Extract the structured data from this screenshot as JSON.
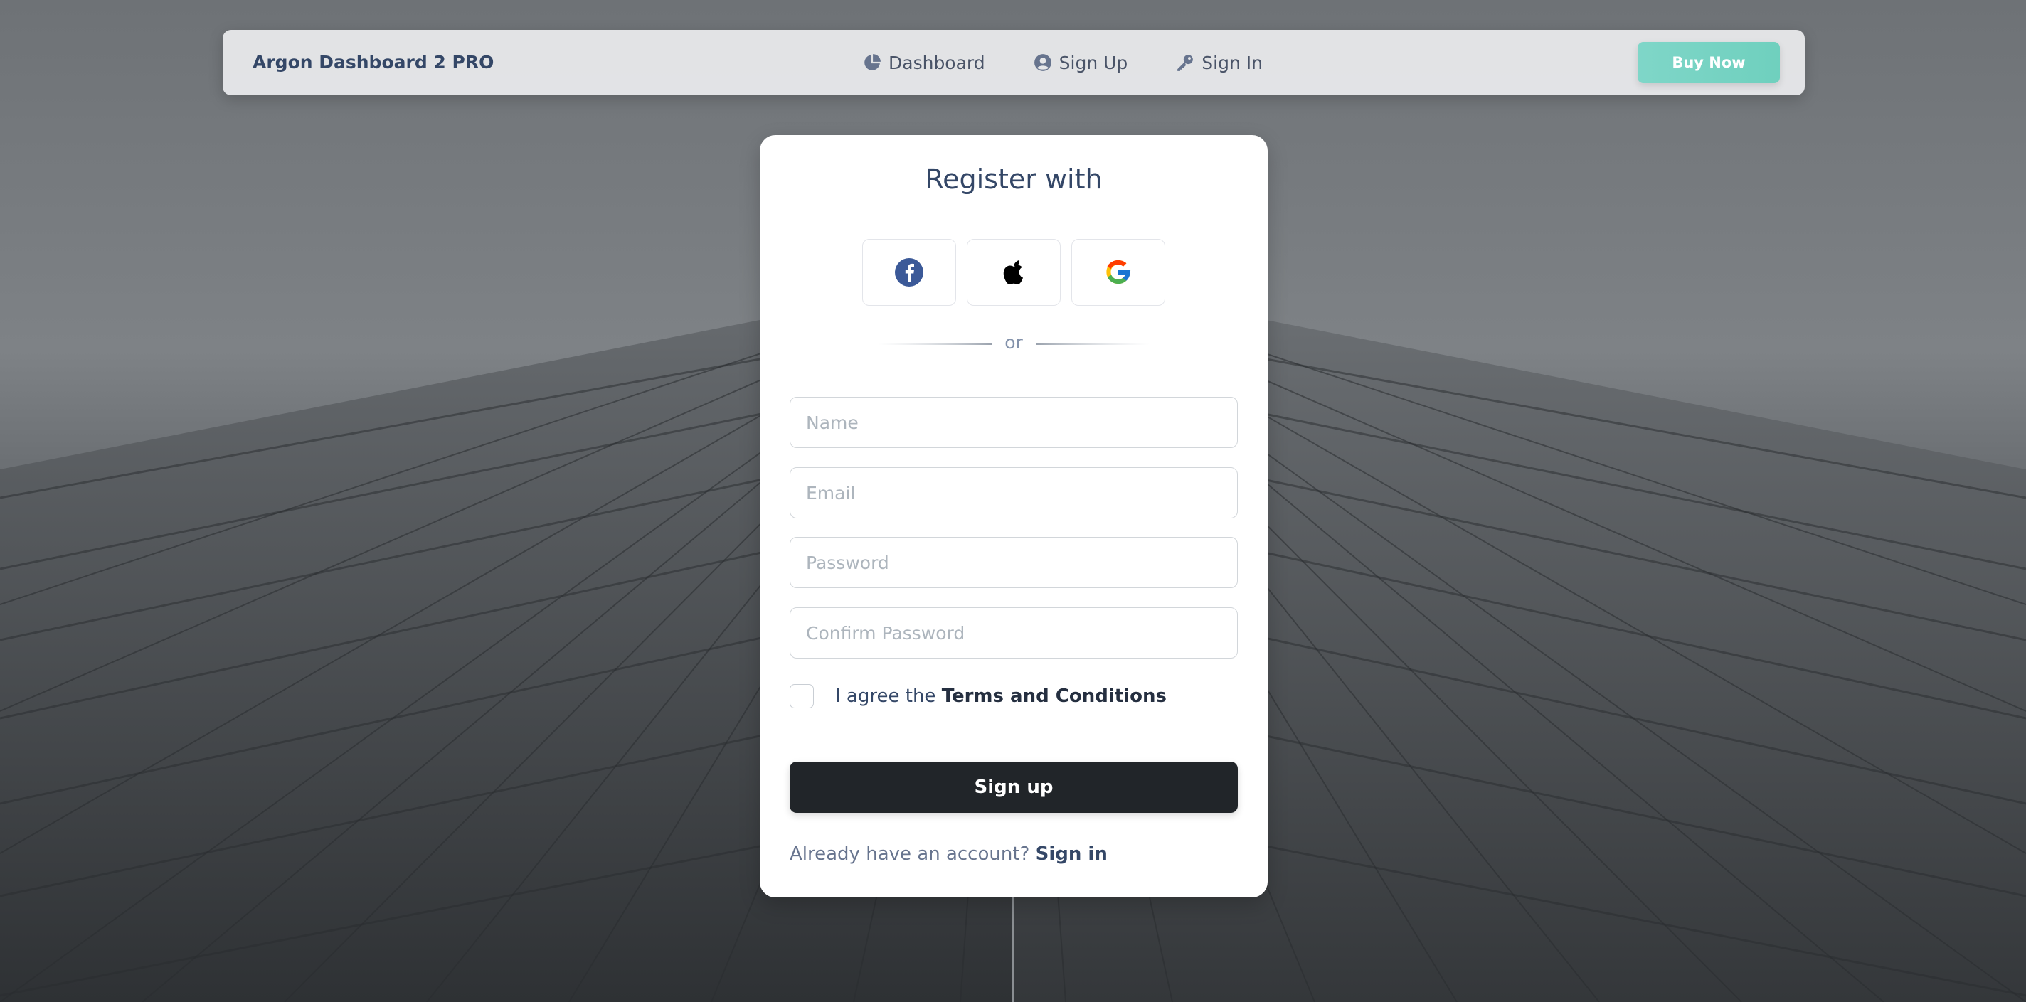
{
  "navbar": {
    "brand": "Argon Dashboard 2 PRO",
    "links": [
      {
        "label": "Dashboard",
        "icon": "pie-chart-icon"
      },
      {
        "label": "Sign Up",
        "icon": "user-circle-icon"
      },
      {
        "label": "Sign In",
        "icon": "key-icon"
      }
    ],
    "buy_label": "Buy Now"
  },
  "card": {
    "title": "Register with",
    "social": [
      {
        "name": "facebook",
        "icon": "facebook-icon",
        "color": "#3b5998"
      },
      {
        "name": "apple",
        "icon": "apple-icon",
        "color": "#000000"
      },
      {
        "name": "google",
        "icon": "google-icon",
        "color": "#4285f4"
      }
    ],
    "divider_text": "or",
    "fields": {
      "name_placeholder": "Name",
      "email_placeholder": "Email",
      "password_placeholder": "Password",
      "confirm_placeholder": "Confirm Password"
    },
    "agree_prefix": "I agree the",
    "terms_label": "Terms and Conditions",
    "submit_label": "Sign up",
    "already_text": "Already have an account?",
    "signin_label": "Sign in"
  },
  "colors": {
    "accent": "#2dce89",
    "dark_button": "#212529",
    "text_primary": "#344767"
  }
}
